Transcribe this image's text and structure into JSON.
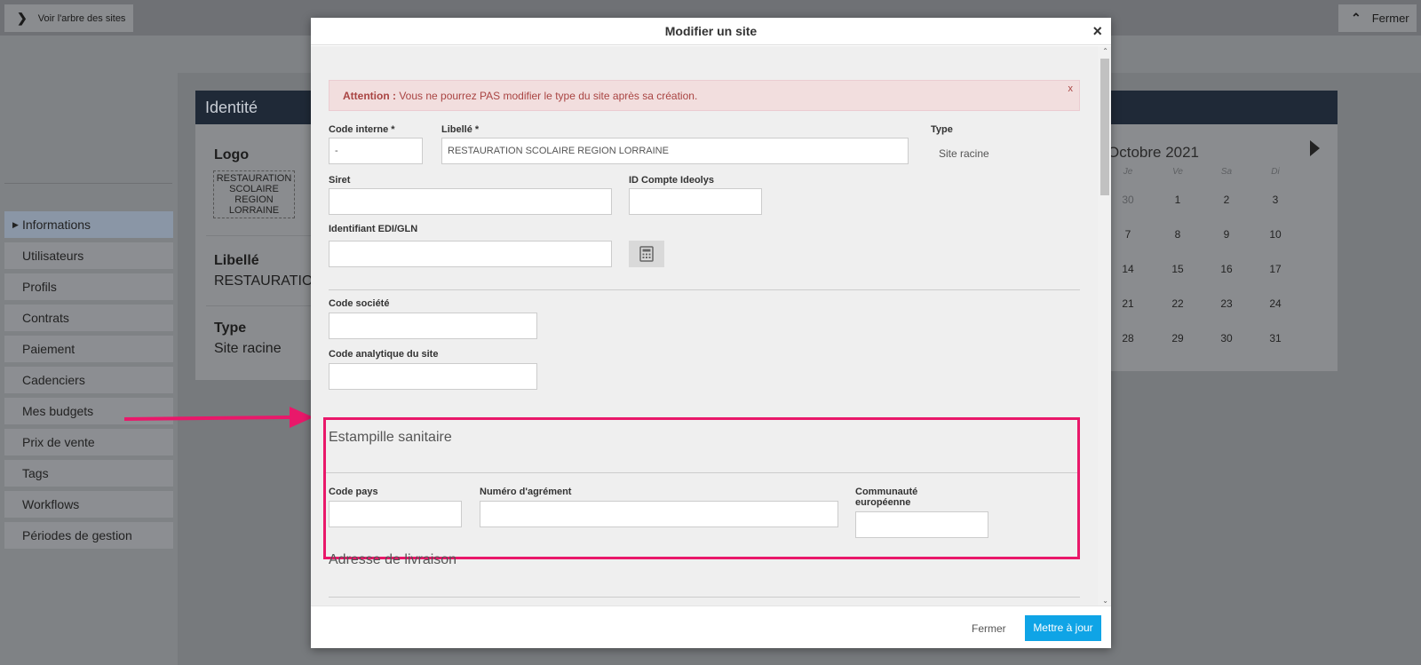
{
  "topbar": {
    "tree_button": "Voir l'arbre des sites",
    "close_button": "Fermer"
  },
  "sidebar": {
    "items": [
      {
        "label": "Informations",
        "active": true
      },
      {
        "label": "Utilisateurs"
      },
      {
        "label": "Profils"
      },
      {
        "label": "Contrats"
      },
      {
        "label": "Paiement"
      },
      {
        "label": "Cadenciers"
      },
      {
        "label": "Mes budgets"
      },
      {
        "label": "Prix de vente"
      },
      {
        "label": "Tags"
      },
      {
        "label": "Workflows"
      },
      {
        "label": "Périodes de gestion"
      }
    ]
  },
  "identity": {
    "header": "Identité",
    "logo_label": "Logo",
    "logo_text": "RESTAURATION SCOLAIRE REGION LORRAINE",
    "libelle_label": "Libellé",
    "libelle_value": "RESTAURATIO",
    "type_label": "Type",
    "type_value": "Site racine"
  },
  "calendar": {
    "month": "Octobre 2021",
    "weekdays": [
      "Je",
      "Ve",
      "Sa",
      "Di"
    ],
    "weeks": [
      [
        "30",
        "1",
        "2",
        "3"
      ],
      [
        "7",
        "8",
        "9",
        "10"
      ],
      [
        "14",
        "15",
        "16",
        "17"
      ],
      [
        "21",
        "22",
        "23",
        "24"
      ],
      [
        "28",
        "29",
        "30",
        "31"
      ]
    ]
  },
  "modal": {
    "title": "Modifier un site",
    "close_icon": "×",
    "alert": {
      "prefix": "Attention :",
      "text": " Vous ne pourrez PAS modifier le type du site après sa création.",
      "close": "x"
    },
    "fields": {
      "code_interne": {
        "label": "Code interne *",
        "value": "-"
      },
      "libelle": {
        "label": "Libellé *",
        "value": "RESTAURATION SCOLAIRE REGION LORRAINE"
      },
      "type": {
        "label": "Type",
        "value": "Site racine"
      },
      "siret": {
        "label": "Siret",
        "value": ""
      },
      "id_compte": {
        "label": "ID Compte Ideolys",
        "value": ""
      },
      "edi": {
        "label": "Identifiant EDI/GLN",
        "value": ""
      },
      "code_societe": {
        "label": "Code société",
        "value": ""
      },
      "code_analytique": {
        "label": "Code analytique du site",
        "value": ""
      },
      "code_pays": {
        "label": "Code pays",
        "value": ""
      },
      "numero_agrement": {
        "label": "Numéro d'agrément",
        "value": ""
      },
      "communaute_1": {
        "label": "Communauté"
      },
      "communaute_2": {
        "label": "européenne"
      },
      "communaute": {
        "value": ""
      }
    },
    "sections": {
      "estampille": "Estampille sanitaire",
      "adresse": "Adresse de livraison"
    },
    "footer": {
      "close": "Fermer",
      "save": "Mettre à jour"
    }
  },
  "colors": {
    "accent": "#0fa4e6",
    "highlight": "#e9186a",
    "alert_text": "#a94442",
    "alert_bg": "#f2dede"
  }
}
